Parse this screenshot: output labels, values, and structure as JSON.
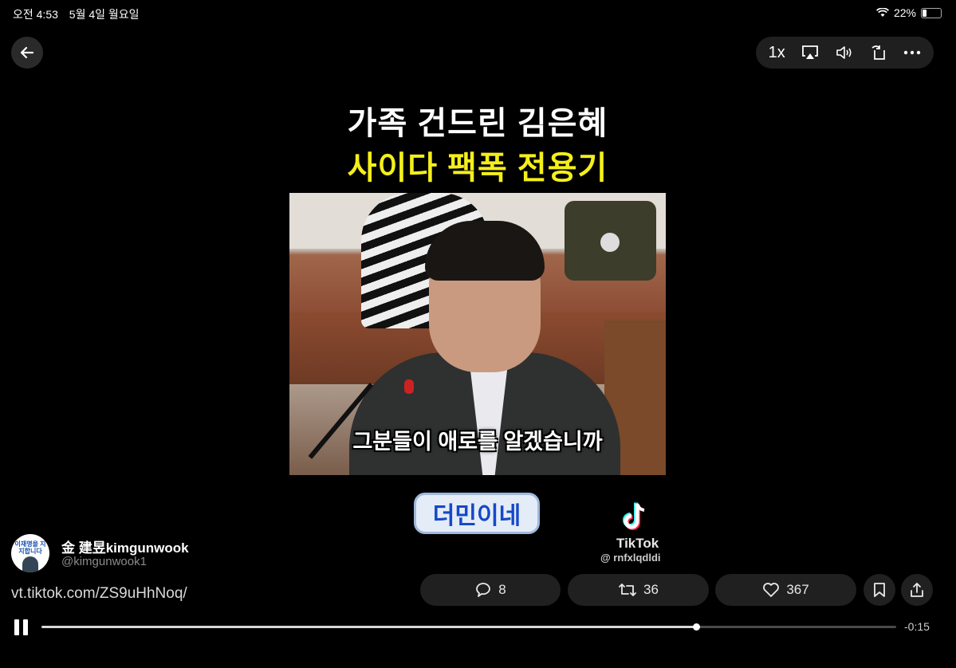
{
  "status_bar": {
    "time": "오전 4:53",
    "date": "5월 4일 월요일",
    "battery_text": "22%",
    "battery_level": 0.22
  },
  "toolbar": {
    "speed_label": "1x",
    "icons": [
      "airplay-icon",
      "volume-icon",
      "rotate-icon",
      "more-icon"
    ]
  },
  "video": {
    "headline_line1": "가족 건드린 김은혜",
    "headline_line2": "사이다 팩폭 전용기",
    "subtitle": "그분들이 애로를 알겠습니까",
    "badge": "더민이네",
    "watermark_name": "TikTok",
    "watermark_handle": "@ rnfxlqdldi"
  },
  "author": {
    "name": "金 建昱kimgunwook",
    "handle": "@kimgunwook1",
    "avatar_text": "이재명을 지지합니다"
  },
  "tweet": {
    "link_text": "vt.tiktok.com/ZS9uHhNoq/"
  },
  "actions": {
    "replies": "8",
    "retweets": "36",
    "likes": "367"
  },
  "playback": {
    "progress": 0.766,
    "time_remaining": "-0:15"
  },
  "colors": {
    "headline_yellow": "#f4ef1a",
    "badge_blue": "#1648c7",
    "background": "#000000"
  }
}
